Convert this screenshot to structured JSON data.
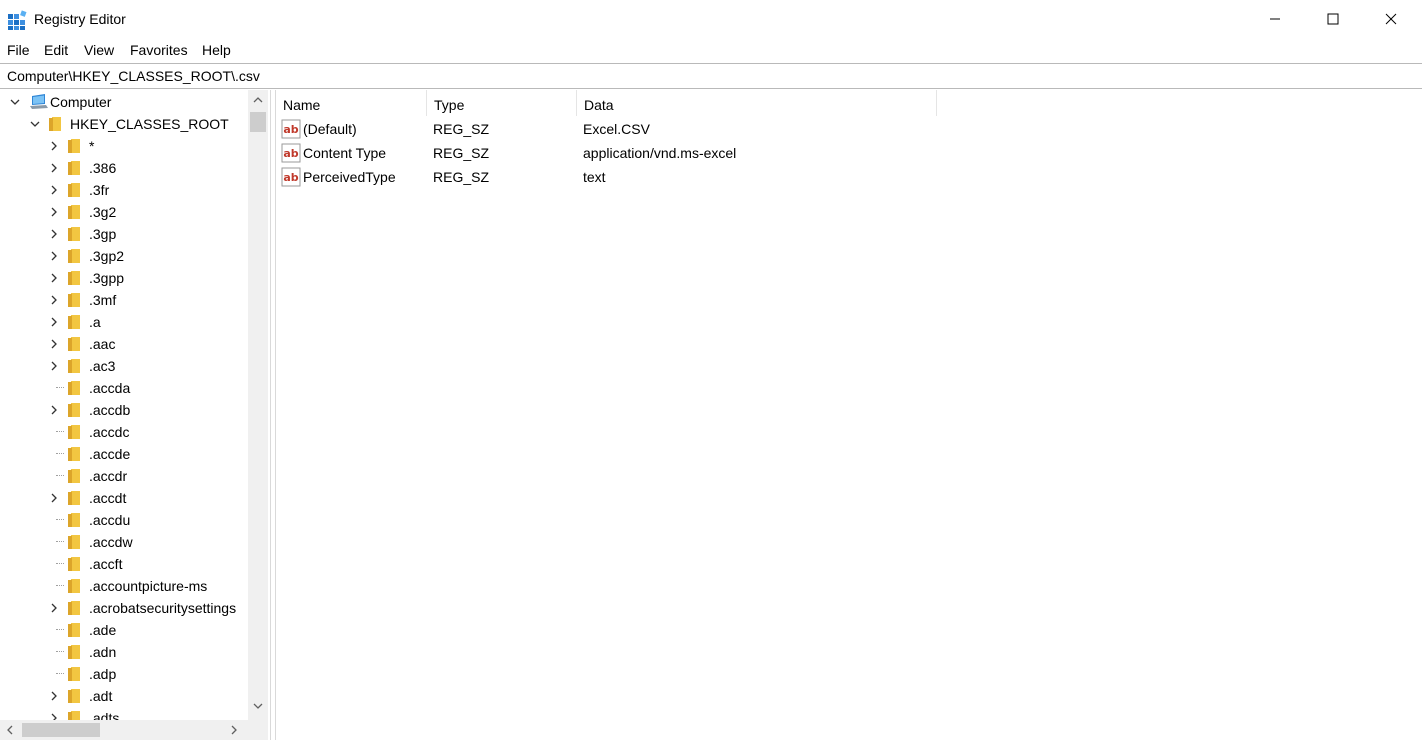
{
  "window": {
    "title": "Registry Editor",
    "icon": "registry-editor-icon",
    "controls": [
      "minimize-icon",
      "maximize-icon",
      "close-icon"
    ]
  },
  "menu": [
    "File",
    "Edit",
    "View",
    "Favorites",
    "Help"
  ],
  "address": {
    "path": "Computer\\HKEY_CLASSES_ROOT\\.csv"
  },
  "tree": {
    "root": "Computer",
    "hive": "HKEY_CLASSES_ROOT",
    "keys": [
      {
        "label": "*",
        "expandable": true
      },
      {
        "label": ".386",
        "expandable": true
      },
      {
        "label": ".3fr",
        "expandable": true
      },
      {
        "label": ".3g2",
        "expandable": true
      },
      {
        "label": ".3gp",
        "expandable": true
      },
      {
        "label": ".3gp2",
        "expandable": true
      },
      {
        "label": ".3gpp",
        "expandable": true
      },
      {
        "label": ".3mf",
        "expandable": true
      },
      {
        "label": ".a",
        "expandable": true
      },
      {
        "label": ".aac",
        "expandable": true
      },
      {
        "label": ".ac3",
        "expandable": true
      },
      {
        "label": ".accda",
        "expandable": false
      },
      {
        "label": ".accdb",
        "expandable": true
      },
      {
        "label": ".accdc",
        "expandable": false
      },
      {
        "label": ".accde",
        "expandable": false
      },
      {
        "label": ".accdr",
        "expandable": false
      },
      {
        "label": ".accdt",
        "expandable": true
      },
      {
        "label": ".accdu",
        "expandable": false
      },
      {
        "label": ".accdw",
        "expandable": false
      },
      {
        "label": ".accft",
        "expandable": false
      },
      {
        "label": ".accountpicture-ms",
        "expandable": false
      },
      {
        "label": ".acrobatsecuritysettings",
        "expandable": true
      },
      {
        "label": ".ade",
        "expandable": false
      },
      {
        "label": ".adn",
        "expandable": false
      },
      {
        "label": ".adp",
        "expandable": false
      },
      {
        "label": ".adt",
        "expandable": true
      },
      {
        "label": ".adts",
        "expandable": true
      }
    ]
  },
  "values": {
    "columns": [
      "Name",
      "Type",
      "Data"
    ],
    "rows": [
      {
        "name": "(Default)",
        "type": "REG_SZ",
        "data": "Excel.CSV"
      },
      {
        "name": "Content Type",
        "type": "REG_SZ",
        "data": "application/vnd.ms-excel"
      },
      {
        "name": "PerceivedType",
        "type": "REG_SZ",
        "data": "text"
      }
    ]
  },
  "colors": {
    "folder": "#f2c641",
    "folder_dark": "#dca52a",
    "string_icon": "#c0392b",
    "computer_icon": "#2f86d6"
  }
}
